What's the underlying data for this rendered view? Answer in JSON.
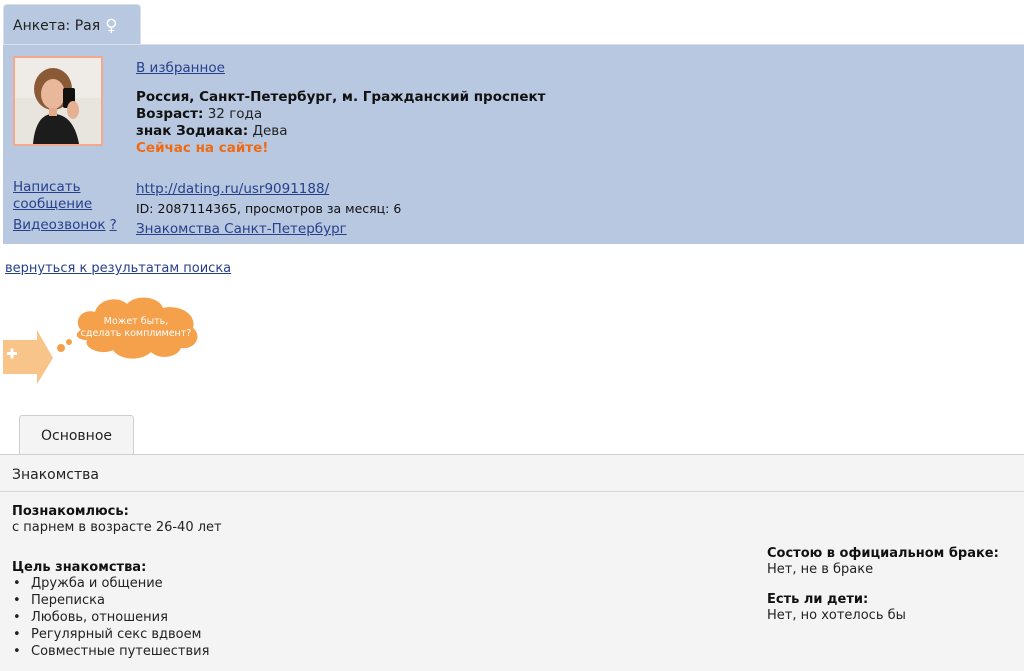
{
  "profile": {
    "tab_label": "Анкета: Рая",
    "gender_symbol": "♀",
    "favorites_link": "В избранное",
    "location": "Россия, Санкт-Петербург, м. Гражданский проспект",
    "age_label": "Возраст:",
    "age_value": "32 года",
    "zodiac_label": "знак Зодиака:",
    "zodiac_value": "Дева",
    "online_status": "Сейчас на сайте!",
    "write_message": "Написать сообщение",
    "video_call": "Видеозвонок",
    "video_call_help": "?",
    "profile_url": "http://dating.ru/usr9091188/",
    "id_line": "ID: 2087114365, просмотров за месяц: 6",
    "city_link": "Знакомства Санкт-Петербург"
  },
  "back_link": "вернуться к результатам поиска",
  "compliment": {
    "line1": "Может быть,",
    "line2": "сделать комплимент?"
  },
  "tabs": [
    {
      "label": "Основное",
      "active": true
    }
  ],
  "section": {
    "title": "Знакомства",
    "seeking_label": "Познакомлюсь:",
    "seeking_value": "с парнем в возрасте 26-40 лет",
    "goal_label": "Цель знакомства:",
    "goals": [
      "Дружба и общение",
      "Переписка",
      "Любовь, отношения",
      "Регулярный секс вдвоем",
      "Совместные путешествия"
    ],
    "marriage_label": "Состою в официальном браке:",
    "marriage_value": "Нет, не в браке",
    "children_label": "Есть ли дети:",
    "children_value": "Нет, но хотелось бы"
  },
  "colors": {
    "panel_bg": "#b8c8e0",
    "link": "#27408b",
    "online": "#f06a14",
    "cloud": "#f5a04a",
    "arrow": "#f8c48a"
  },
  "icons": [
    "female-gender-icon",
    "plus-arrow-icon",
    "thought-cloud-icon",
    "profile-photo"
  ]
}
